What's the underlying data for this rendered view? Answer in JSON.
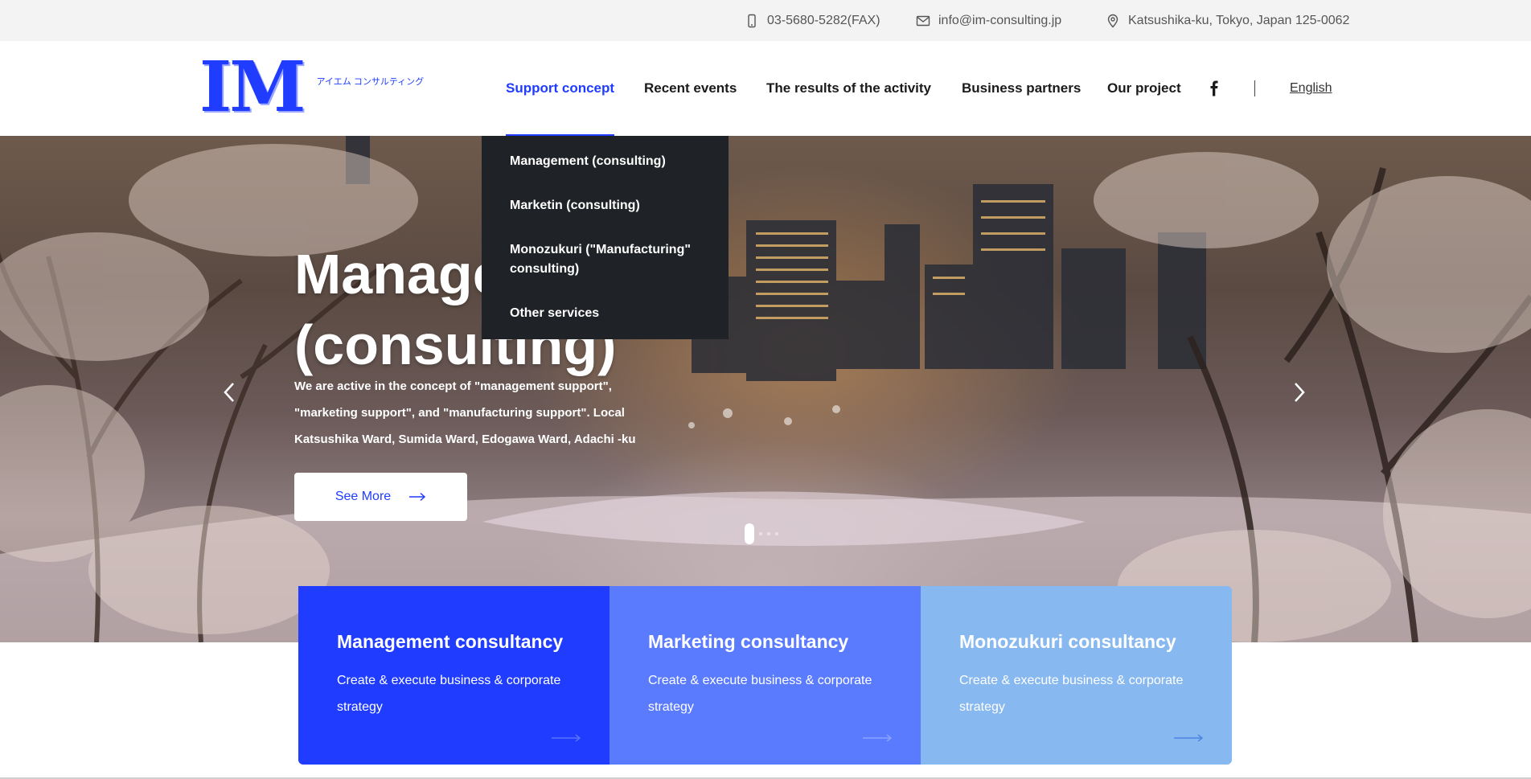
{
  "topbar": {
    "phone": "03-5680-5282(FAX)",
    "email": "info@im-consulting.jp",
    "address": "Katsushika-ku, Tokyo, Japan 125-0062",
    "icons": [
      "phone-icon",
      "mail-icon",
      "map-pin-icon"
    ]
  },
  "header": {
    "logo_mark": "IM",
    "logo_sub": "アイエム コンサルティング",
    "nav": {
      "support": "Support concept",
      "events": "Recent events",
      "results": "The results of the activity",
      "partners": "Business partners",
      "project": "Our project"
    },
    "language": "English"
  },
  "dropdown": {
    "items": [
      "Management (consulting)",
      "Marketin (consulting)",
      "Monozukuri (\"Manufacturing\" consulting)",
      "Other services"
    ]
  },
  "hero": {
    "title": "Management (consulting)",
    "description": "We are active in the concept of \"management support\", \"marketing support\", and \"manufacturing support\". Local Katsushika Ward, Sumida Ward, Edogawa Ward, Adachi -ku",
    "button": "See More"
  },
  "cards": [
    {
      "title": "Management consultancy",
      "desc": "Create & execute business & corporate strategy"
    },
    {
      "title": "Marketing consultancy",
      "desc": "Create & execute business & corporate strategy"
    },
    {
      "title": "Monozukuri consultancy",
      "desc": "Create & execute business & corporate strategy"
    }
  ],
  "colors": {
    "accent": "#1f3cff",
    "card1": "#1f3cff",
    "card2": "#5b7bff",
    "card3": "#87b8ef",
    "dropdown_bg": "#1f2226"
  }
}
